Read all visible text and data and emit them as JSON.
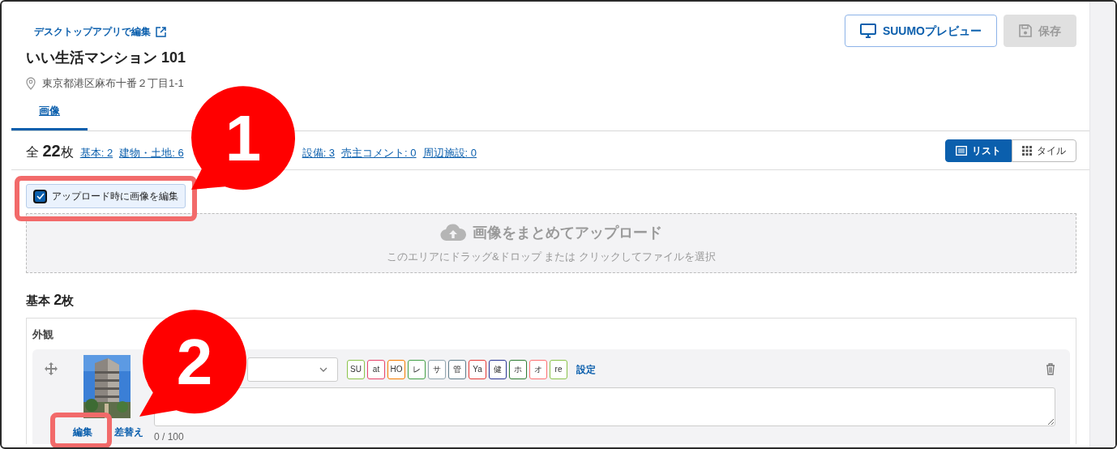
{
  "header": {
    "desktop_link": "デスクトップアプリで編集",
    "title": "いい生活マンション 101",
    "address": "東京都港区麻布十番２丁目1-1",
    "buttons": [
      {
        "kind": "preview",
        "label": "SUUMOプレビュー",
        "disabled": false
      },
      {
        "kind": "save",
        "label": "保存",
        "disabled": true
      }
    ]
  },
  "tabs": [
    {
      "label": "画像",
      "selected": true
    }
  ],
  "summary": {
    "prefix": "全",
    "count": "22",
    "unit": "枚",
    "links": [
      "基本: 2",
      "建物・土地: 6",
      "設備: 3",
      "売主コメント: 0",
      "周辺施設: 0"
    ]
  },
  "view_toggle": [
    {
      "kind": "list",
      "label": "リスト",
      "selected": true
    },
    {
      "kind": "tile",
      "label": "タイル",
      "selected": false
    }
  ],
  "edit_on_upload": {
    "label": "アップロード時に画像を編集",
    "checked": true
  },
  "dropzone": {
    "title": "画像をまとめてアップロード",
    "hint": "このエリアにドラッグ&ドロップ または クリックしてファイルを選択"
  },
  "section": {
    "title": "基本",
    "count": "2",
    "unit": "枚",
    "group": "外観",
    "item": {
      "tags": [
        {
          "label": "SU",
          "color": "#8bc34a"
        },
        {
          "label": "at",
          "color": "#e8436a"
        },
        {
          "label": "HO",
          "color": "#f57c00"
        },
        {
          "label": "レ",
          "color": "#43a047"
        },
        {
          "label": "サ",
          "color": "#90a4ae"
        },
        {
          "label": "管",
          "color": "#607d8b"
        },
        {
          "label": "Ya",
          "color": "#e53935"
        },
        {
          "label": "健",
          "color": "#283593"
        },
        {
          "label": "ホ",
          "color": "#2e7d32"
        },
        {
          "label": "オ",
          "color": "#ff7070"
        },
        {
          "label": "re",
          "color": "#8bc34a"
        }
      ],
      "settings_link": "設定",
      "counter": "0 / 100",
      "actions": [
        "編集",
        "差替え"
      ]
    }
  },
  "annotations": [
    {
      "number": "1"
    },
    {
      "number": "2"
    }
  ]
}
